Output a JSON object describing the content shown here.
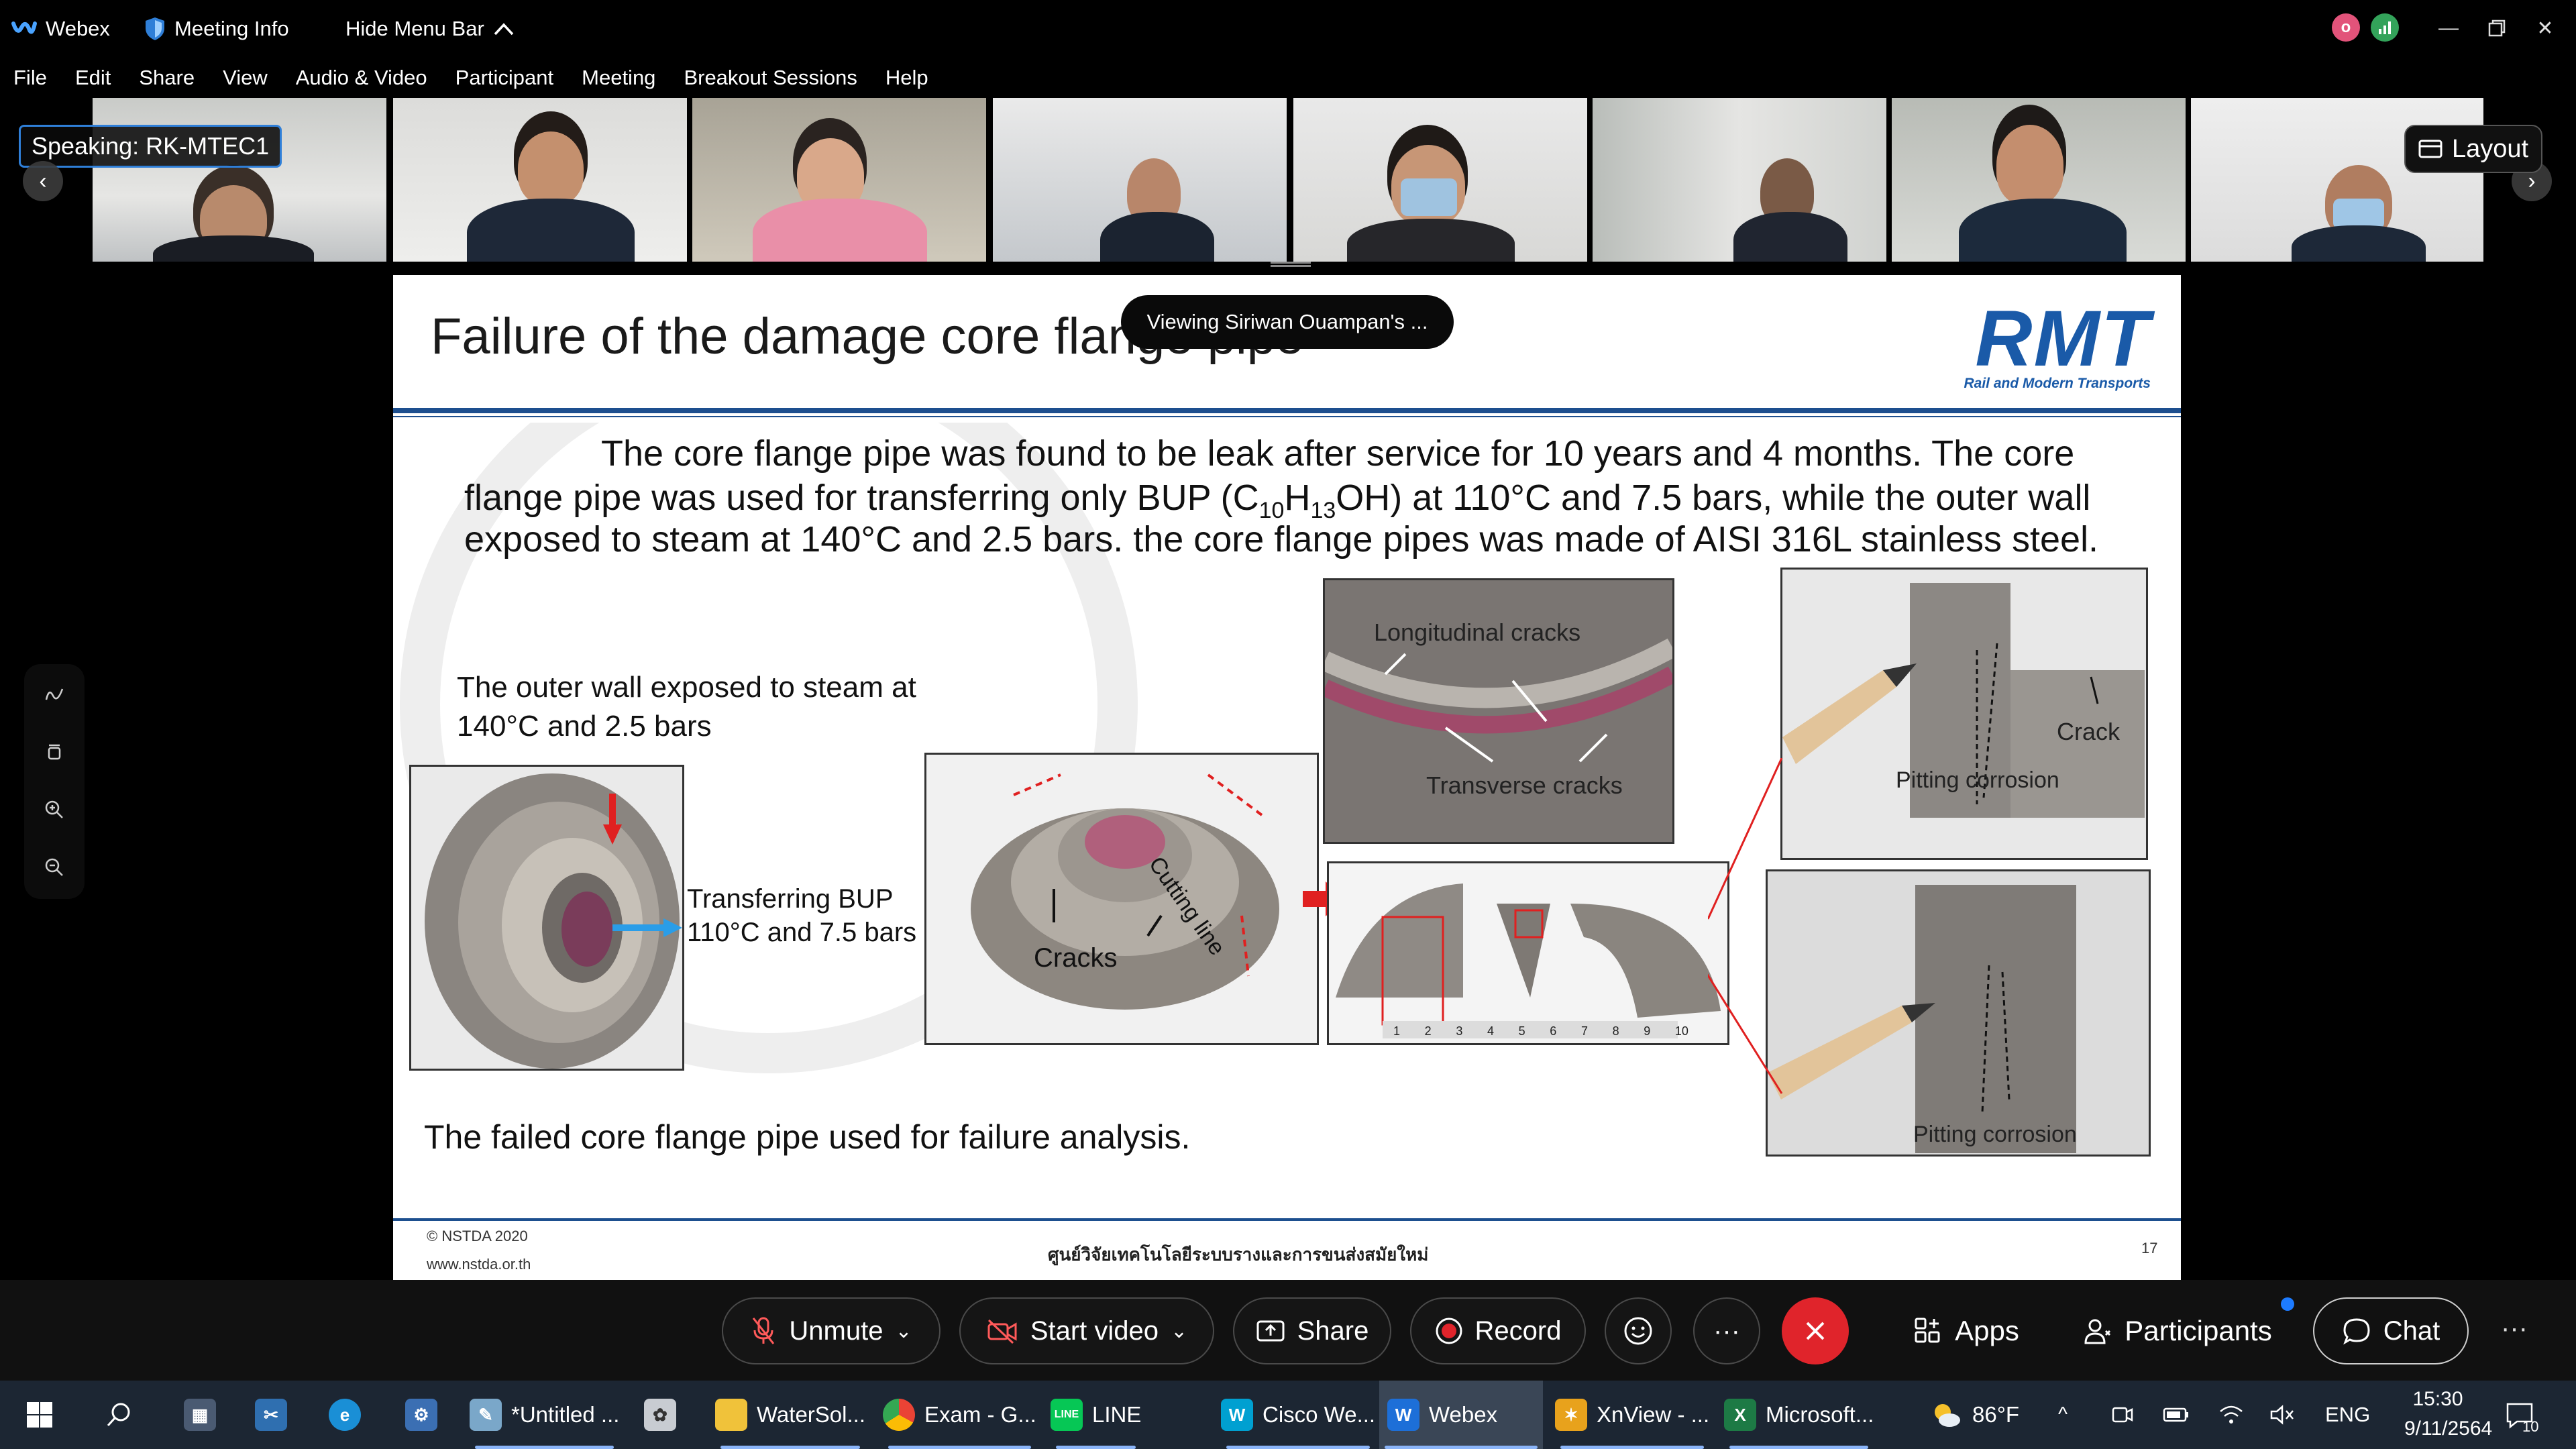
{
  "titlebar": {
    "app_name": "Webex",
    "meeting_info": "Meeting Info",
    "hide_menu_bar": "Hide Menu Bar",
    "chevron": "^"
  },
  "menu": [
    "File",
    "Edit",
    "Share",
    "View",
    "Audio & Video",
    "Participant",
    "Meeting",
    "Breakout Sessions",
    "Help"
  ],
  "filmstrip": {
    "speaking_label": "Speaking: RK-MTEC1",
    "layout_label": "Layout"
  },
  "toast": "Viewing Siriwan Ouampan's ...",
  "slide": {
    "title": "Failure of the damage core flange pipe",
    "logo_text": "RMT",
    "logo_subtitle": "Rail and Modern Transports",
    "para_line1": "The core flange pipe was found to be leak after service for 10 years and 4 months. The core",
    "para_line2_a": "flange pipe was used for transferring only BUP (C",
    "para_line2_sub1": "10",
    "para_line2_b": "H",
    "para_line2_sub2": "13",
    "para_line2_c": "OH) at 110°C and 7.5 bars, while the outer wall",
    "para_line3": "exposed to steam at 140°C and 2.5 bars. the core flange pipes was made of AISI 316L stainless steel.",
    "outer_wall_line1": "The outer wall exposed to steam at",
    "outer_wall_line2": "140°C and 2.5 bars",
    "transfer_line1": "Transferring BUP",
    "transfer_line2": "110°C and 7.5 bars",
    "cracks_label": "Cracks",
    "cutting_line": "Cutting line",
    "longitudinal_cracks": "Longitudinal cracks",
    "transverse_cracks": "Transverse cracks",
    "crack_label": "Crack",
    "pitting1": "Pitting corrosion",
    "pitting2": "Pitting corrosion",
    "failed_caption": "The failed core flange pipe used for failure analysis.",
    "footer_copy1": "© NSTDA 2020",
    "footer_copy2": "www.nstda.or.th",
    "footer_center": "ศูนย์วิจัยเทคโนโลยีระบบรางและการขนส่งสมัยใหม่",
    "page_number": "17",
    "ruler_ticks": [
      "1",
      "2",
      "3",
      "4",
      "5",
      "6",
      "7",
      "8",
      "9",
      "10"
    ]
  },
  "controls": {
    "unmute": "Unmute",
    "start_video": "Start video",
    "share": "Share",
    "record": "Record",
    "more": "···",
    "apps": "Apps",
    "participants": "Participants",
    "chat": "Chat"
  },
  "taskbar": {
    "items": [
      "*Untitled ...",
      "WaterSol...",
      "Exam - G...",
      "LINE",
      "Cisco We...",
      "Webex",
      "XnView - ...",
      "Microsoft..."
    ],
    "weather": "86°F",
    "language": "ENG",
    "time": "15:30",
    "date": "9/11/2564",
    "notification_count": "10"
  },
  "colors": {
    "webex_blue": "#2f7fd8",
    "end_call_red": "#e0242b",
    "record_red": "#e0242b",
    "slide_blue": "#1d4f8f",
    "rmt_blue": "#1a5aa8"
  }
}
